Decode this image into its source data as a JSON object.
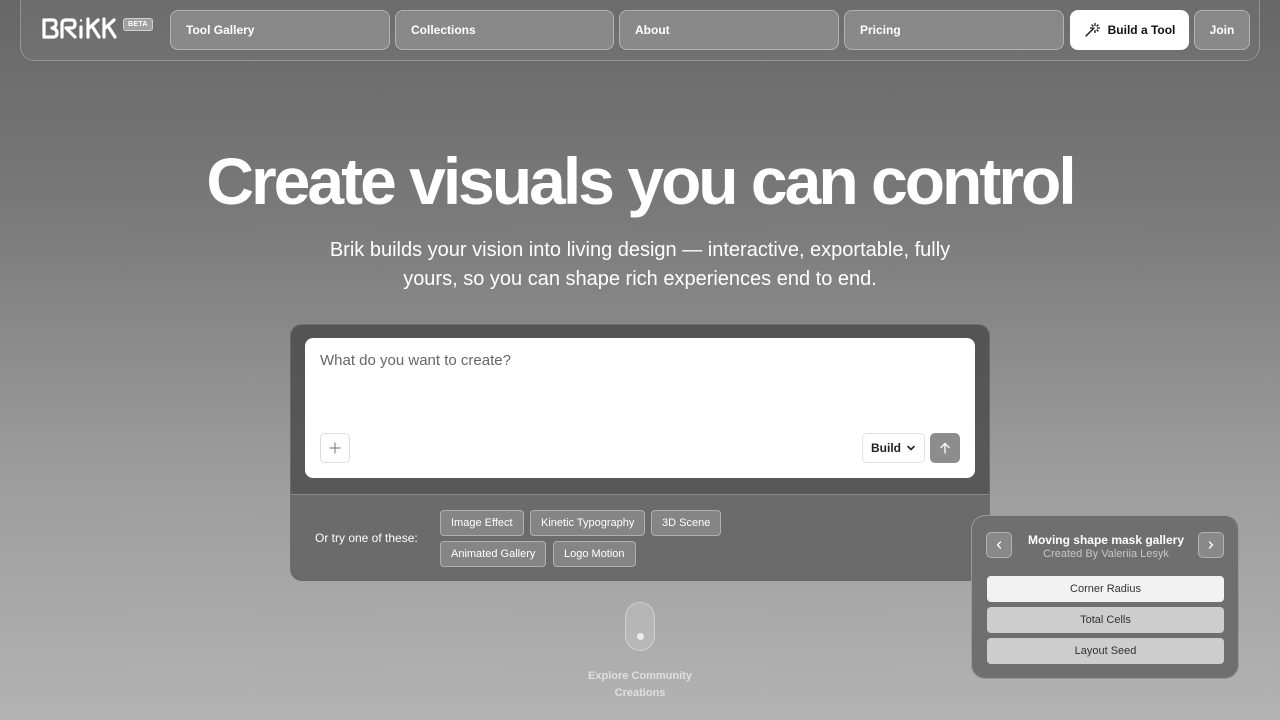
{
  "nav": {
    "logo_text": "BRIK",
    "beta_badge": "BETA",
    "items": [
      {
        "label": "Tool Gallery"
      },
      {
        "label": "Collections"
      },
      {
        "label": "About"
      },
      {
        "label": "Pricing"
      }
    ],
    "build_tool_label": "Build a Tool",
    "join_label": "Join"
  },
  "hero": {
    "title": "Create visuals you can control",
    "subtitle": "Brik builds your vision into living design — interactive, exportable, fully yours, so you can shape rich experiences end to end."
  },
  "prompt": {
    "placeholder": "What do you want to create?",
    "mode": "Build",
    "try_label": "Or try one of these:",
    "suggestions": [
      "Image Effect",
      "Kinetic Typography",
      "3D Scene",
      "Animated Gallery",
      "Logo Motion"
    ]
  },
  "scroll_hint": {
    "label": "Explore Community Creations"
  },
  "showcase_panel": {
    "title": "Moving shape mask gallery",
    "subtitle": "Created By Valeriia Lesyk",
    "params": [
      "Corner Radius",
      "Total Cells",
      "Layout Seed"
    ]
  },
  "icons": {
    "build_tool": "magic-wand-icon",
    "attach": "plus-icon",
    "mode_dropdown": "chevron-down-icon",
    "send": "arrow-up-icon",
    "prev": "chevron-left-icon",
    "next": "chevron-right-icon",
    "scroll": "mouse-icon"
  },
  "colors": {
    "primary_button_bg": "#ffffff",
    "send_button_bg": "#8d8d8d"
  }
}
